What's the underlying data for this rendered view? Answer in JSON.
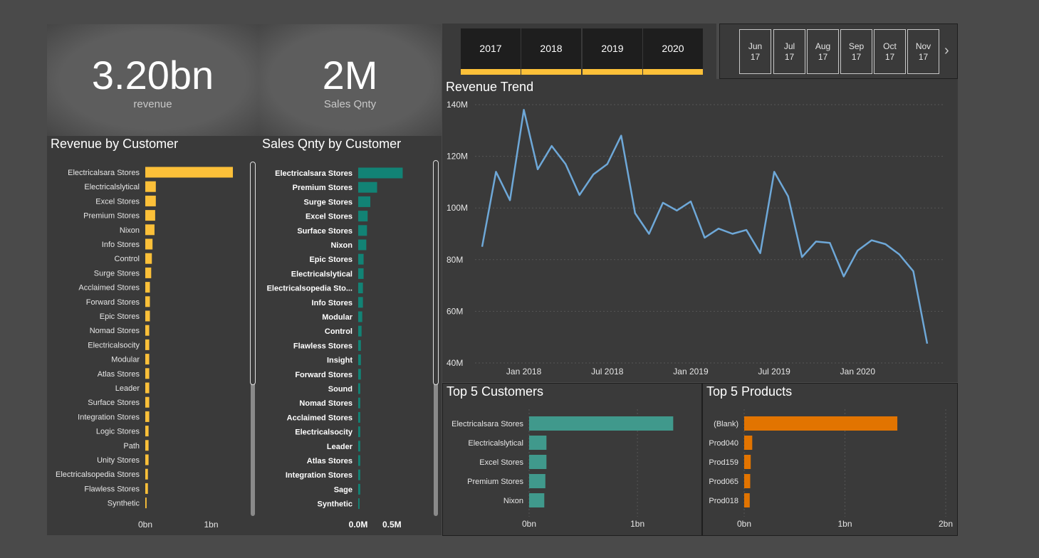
{
  "kpis": {
    "revenue": {
      "value": "3.20bn",
      "label": "revenue"
    },
    "sales_qnty": {
      "value": "2M",
      "label": "Sales Qnty"
    }
  },
  "years": [
    "2017",
    "2018",
    "2019",
    "2020"
  ],
  "months": [
    {
      "m": "Jun",
      "y": "17"
    },
    {
      "m": "Jul",
      "y": "17"
    },
    {
      "m": "Aug",
      "y": "17"
    },
    {
      "m": "Sep",
      "y": "17"
    },
    {
      "m": "Oct",
      "y": "17"
    },
    {
      "m": "Nov",
      "y": "17"
    }
  ],
  "icons": {
    "next": "chevron-right-icon"
  },
  "colors": {
    "revenue_bar": "#fcc039",
    "qty_bar": "#128375",
    "top_customers_bar": "#40998c",
    "top_products_bar": "#e27400",
    "trend_line": "#6ea8d8"
  },
  "chart_data": [
    {
      "id": "revenue_by_customer",
      "type": "bar",
      "orientation": "horizontal",
      "title": "Revenue by Customer",
      "categories": [
        "Electricalsara Stores",
        "Electricalslytical",
        "Excel Stores",
        "Premium Stores",
        "Nixon",
        "Info Stores",
        "Control",
        "Surge Stores",
        "Acclaimed Stores",
        "Forward Stores",
        "Epic Stores",
        "Nomad Stores",
        "Electricalsocity",
        "Modular",
        "Atlas Stores",
        "Leader",
        "Surface Stores",
        "Integration Stores",
        "Logic Stores",
        "Path",
        "Unity Stores",
        "Electricalsopedia Stores",
        "Flawless Stores",
        "Synthetic"
      ],
      "values": [
        1.33,
        0.16,
        0.16,
        0.15,
        0.14,
        0.11,
        0.1,
        0.09,
        0.07,
        0.07,
        0.07,
        0.06,
        0.06,
        0.06,
        0.06,
        0.06,
        0.06,
        0.06,
        0.05,
        0.05,
        0.05,
        0.04,
        0.04,
        0.02
      ],
      "xlim": [
        0,
        1.4
      ],
      "x_ticks": [
        {
          "v": 0,
          "label": "0bn"
        },
        {
          "v": 1,
          "label": "1bn"
        }
      ]
    },
    {
      "id": "sales_qnty_by_customer",
      "type": "bar",
      "orientation": "horizontal",
      "title": "Sales Qnty by Customer",
      "categories": [
        "Electricalsara Stores",
        "Premium Stores",
        "Surge Stores",
        "Excel Stores",
        "Surface Stores",
        "Nixon",
        "Epic Stores",
        "Electricalslytical",
        "Electricalsopedia Sto...",
        "Info Stores",
        "Modular",
        "Control",
        "Flawless Stores",
        "Insight",
        "Forward Stores",
        "Sound",
        "Nomad Stores",
        "Acclaimed Stores",
        "Electricalsocity",
        "Leader",
        "Atlas Stores",
        "Integration Stores",
        "Sage",
        "Synthetic"
      ],
      "values": [
        0.66,
        0.28,
        0.18,
        0.14,
        0.13,
        0.12,
        0.08,
        0.08,
        0.07,
        0.07,
        0.06,
        0.05,
        0.04,
        0.04,
        0.04,
        0.03,
        0.03,
        0.03,
        0.03,
        0.03,
        0.03,
        0.03,
        0.03,
        0.02
      ],
      "xlim": [
        0,
        0.75
      ],
      "x_ticks": [
        {
          "v": 0,
          "label": "0.0M"
        },
        {
          "v": 0.5,
          "label": "0.5M"
        }
      ]
    },
    {
      "id": "revenue_trend",
      "type": "line",
      "title": "Revenue Trend",
      "x": [
        "2017-10",
        "2017-11",
        "2017-12",
        "2018-01",
        "2018-02",
        "2018-03",
        "2018-04",
        "2018-05",
        "2018-06",
        "2018-07",
        "2018-08",
        "2018-09",
        "2018-10",
        "2018-11",
        "2018-12",
        "2019-01",
        "2019-02",
        "2019-03",
        "2019-04",
        "2019-05",
        "2019-06",
        "2019-07",
        "2019-08",
        "2019-09",
        "2019-10",
        "2019-11",
        "2019-12",
        "2020-01",
        "2020-02",
        "2020-03",
        "2020-04",
        "2020-05",
        "2020-06"
      ],
      "values": [
        85,
        114,
        103,
        138,
        115,
        124,
        117,
        105,
        113,
        117,
        128,
        98,
        90,
        102,
        99,
        102.5,
        88.5,
        92,
        90,
        91.5,
        82.5,
        114,
        104.5,
        81,
        87,
        86.5,
        73.5,
        83.5,
        87.5,
        86,
        82,
        75.5,
        47.5
      ],
      "ylim": [
        40,
        140
      ],
      "y_ticks": [
        {
          "v": 40,
          "label": "40M"
        },
        {
          "v": 60,
          "label": "60M"
        },
        {
          "v": 80,
          "label": "80M"
        },
        {
          "v": 100,
          "label": "100M"
        },
        {
          "v": 120,
          "label": "120M"
        },
        {
          "v": 140,
          "label": "140M"
        }
      ],
      "x_ticks": [
        {
          "v": 3,
          "label": "Jan 2018"
        },
        {
          "v": 9,
          "label": "Jul 2018"
        },
        {
          "v": 15,
          "label": "Jan 2019"
        },
        {
          "v": 21,
          "label": "Jul 2019"
        },
        {
          "v": 27,
          "label": "Jan 2020"
        }
      ],
      "grid": true
    },
    {
      "id": "top5_customers",
      "type": "bar",
      "orientation": "horizontal",
      "title": "Top 5 Customers",
      "categories": [
        "Electricalsara Stores",
        "Electricalslytical",
        "Excel Stores",
        "Premium Stores",
        "Nixon"
      ],
      "values": [
        1.33,
        0.16,
        0.16,
        0.15,
        0.14
      ],
      "xlim": [
        0,
        1.4
      ],
      "x_ticks": [
        {
          "v": 0,
          "label": "0bn"
        },
        {
          "v": 1,
          "label": "1bn"
        }
      ]
    },
    {
      "id": "top5_products",
      "type": "bar",
      "orientation": "horizontal",
      "title": "Top 5 Products",
      "categories": [
        "(Blank)",
        "Prod040",
        "Prod159",
        "Prod065",
        "Prod018"
      ],
      "values": [
        1.52,
        0.08,
        0.065,
        0.06,
        0.055
      ],
      "xlim": [
        0,
        2
      ],
      "x_ticks": [
        {
          "v": 0,
          "label": "0bn"
        },
        {
          "v": 1,
          "label": "1bn"
        },
        {
          "v": 2,
          "label": "2bn"
        }
      ]
    }
  ]
}
